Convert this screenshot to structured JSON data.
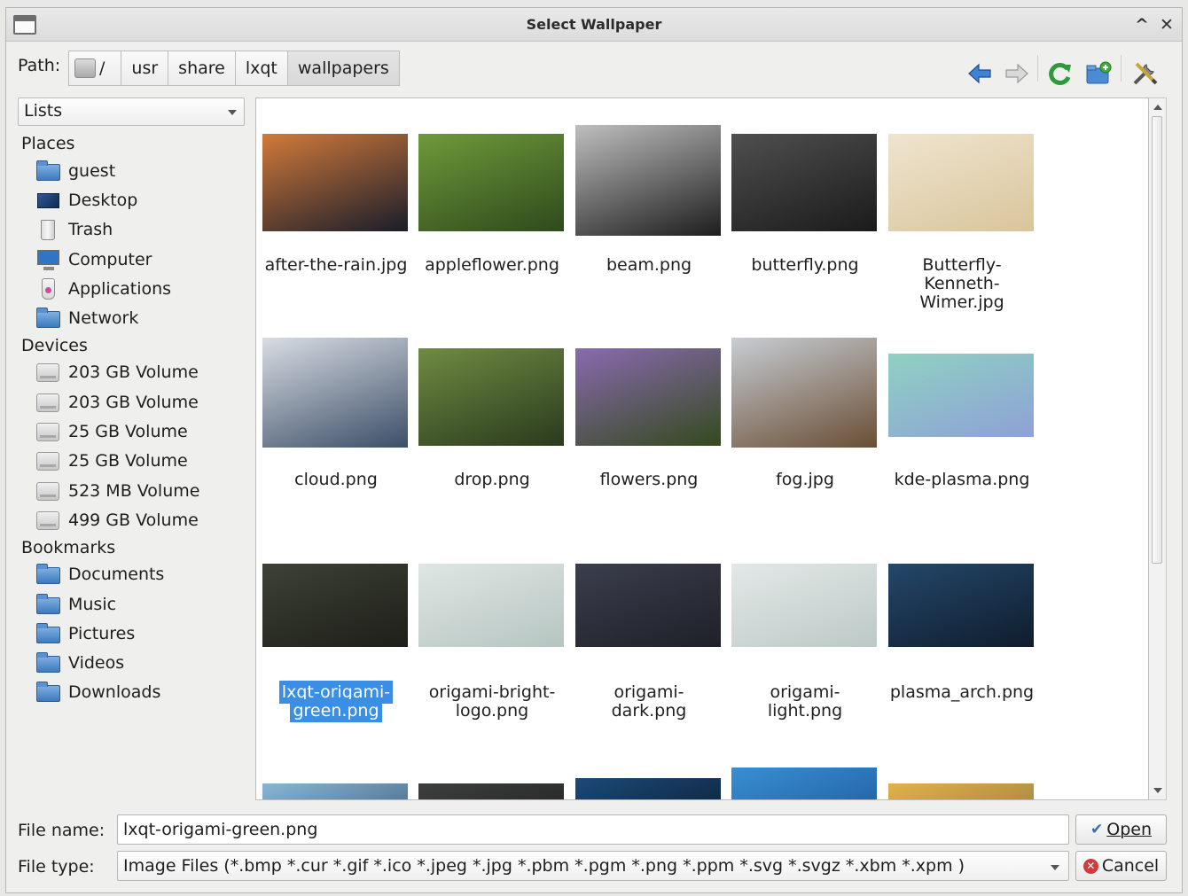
{
  "window": {
    "title": "Select Wallpaper"
  },
  "titlebar": {
    "collapse_glyph": "^",
    "close_glyph": "✕"
  },
  "path_bar": {
    "label": "Path:",
    "crumbs": [
      "/",
      "usr",
      "share",
      "lxqt",
      "wallpapers"
    ]
  },
  "toolbar": {
    "icons": [
      "back-arrow-icon",
      "forward-arrow-icon",
      "reload-icon",
      "new-folder-icon",
      "settings-tools-icon"
    ]
  },
  "sidebar": {
    "view_combo": "Lists",
    "places_title": "Places",
    "places": [
      "guest",
      "Desktop",
      "Trash",
      "Computer",
      "Applications",
      "Network"
    ],
    "devices_title": "Devices",
    "devices": [
      "203 GB Volume",
      "203 GB Volume",
      "25 GB Volume",
      "25 GB Volume",
      "523 MB Volume",
      "499 GB Volume"
    ],
    "bookmarks_title": "Bookmarks",
    "bookmarks": [
      "Documents",
      "Music",
      "Pictures",
      "Videos",
      "Downloads"
    ]
  },
  "files": [
    {
      "name": "after-the-rain.jpg",
      "lines": [
        "after-the-rain.jpg"
      ],
      "c1": "#d27a3a",
      "c2": "#1a1d2a",
      "selected": false
    },
    {
      "name": "appleflower.png",
      "lines": [
        "appleflower.png"
      ],
      "c1": "#6f9a3a",
      "c2": "#2e4a1c",
      "selected": false
    },
    {
      "name": "beam.png",
      "lines": [
        "beam.png"
      ],
      "c1": "#bfbfbf",
      "c2": "#1d1d1d",
      "selected": false
    },
    {
      "name": "butterfly.png",
      "lines": [
        "butterfly.png"
      ],
      "c1": "#4f4f4f",
      "c2": "#1b1b1b",
      "selected": false
    },
    {
      "name": "Butterfly-Kenneth-Wimer.jpg",
      "lines": [
        "Butterfly-",
        "Kenneth-",
        "Wimer.jpg"
      ],
      "c1": "#efe4cf",
      "c2": "#d9c59b",
      "selected": false
    },
    {
      "name": "cloud.png",
      "lines": [
        "cloud.png"
      ],
      "c1": "#d9dde3",
      "c2": "#3c4e68",
      "selected": false
    },
    {
      "name": "drop.png",
      "lines": [
        "drop.png"
      ],
      "c1": "#6f8b42",
      "c2": "#2a3a1d",
      "selected": false
    },
    {
      "name": "flowers.png",
      "lines": [
        "flowers.png"
      ],
      "c1": "#8a6ab0",
      "c2": "#334a1e",
      "selected": false
    },
    {
      "name": "fog.jpg",
      "lines": [
        "fog.jpg"
      ],
      "c1": "#c7cdd4",
      "c2": "#6a4e34",
      "selected": false
    },
    {
      "name": "kde-plasma.png",
      "lines": [
        "kde-plasma.png"
      ],
      "c1": "#8fd1c2",
      "c2": "#8ea1d6",
      "selected": false
    },
    {
      "name": "lxqt-origami-green.png",
      "lines": [
        "lxqt-origami-",
        "green.png"
      ],
      "c1": "#3e4136",
      "c2": "#1d1f19",
      "selected": true
    },
    {
      "name": "origami-bright-logo.png",
      "lines": [
        "origami-bright-",
        "logo.png"
      ],
      "c1": "#dfe6e4",
      "c2": "#b6c5c1",
      "selected": false
    },
    {
      "name": "origami-dark.png",
      "lines": [
        "origami-",
        "dark.png"
      ],
      "c1": "#3b3e4c",
      "c2": "#1e2029",
      "selected": false
    },
    {
      "name": "origami-light.png",
      "lines": [
        "origami-",
        "light.png"
      ],
      "c1": "#e3e8e7",
      "c2": "#bcc9c6",
      "selected": false
    },
    {
      "name": "plasma_arch.png",
      "lines": [
        "plasma_arch.png"
      ],
      "c1": "#24476a",
      "c2": "#0f1d2d",
      "selected": false
    },
    {
      "name": "",
      "lines": [],
      "c1": "#8ab6d6",
      "c2": "#3c5d7e",
      "selected": false
    },
    {
      "name": "",
      "lines": [],
      "c1": "#3c3f3d",
      "c2": "#1f2221",
      "selected": false
    },
    {
      "name": "",
      "lines": [],
      "c1": "#1b4a78",
      "c2": "#0b1e33",
      "selected": false
    },
    {
      "name": "",
      "lines": [],
      "c1": "#3a8ed3",
      "c2": "#1f5ea1",
      "selected": false
    },
    {
      "name": "",
      "lines": [],
      "c1": "#e0b24c",
      "c2": "#9a7a3c",
      "selected": false
    }
  ],
  "bottom": {
    "file_name_label": "File name:",
    "file_name_value": "lxqt-origami-green.png",
    "file_type_label": "File type:",
    "file_type_value": "Image Files (*.bmp *.cur *.gif *.ico *.jpeg *.jpg *.pbm *.pgm *.png *.ppm *.svg *.svgz *.xbm *.xpm )",
    "open_label": "Open",
    "cancel_label": "Cancel"
  }
}
